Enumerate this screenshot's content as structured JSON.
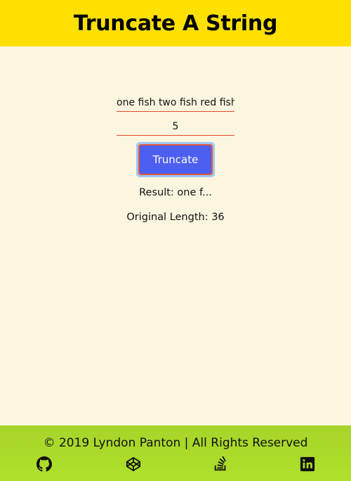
{
  "header": {
    "title": "Truncate A String"
  },
  "form": {
    "text_value": "one fish two fish red fish",
    "num_value": "5",
    "button_label": "Truncate"
  },
  "output": {
    "result": "Result: one f...",
    "original_length": "Original Length: 36"
  },
  "footer": {
    "copyright": "© 2019 Lyndon Panton | All Rights Reserved",
    "icons": [
      "github-icon",
      "codepen-icon",
      "stack-overflow-icon",
      "linkedin-icon"
    ]
  },
  "colors": {
    "header_bg": "#ffe000",
    "page_bg": "#fcf5e0",
    "footer_bg": "#aedb2a",
    "button_bg": "#4d5ff0",
    "accent_border": "#e24b2e"
  }
}
